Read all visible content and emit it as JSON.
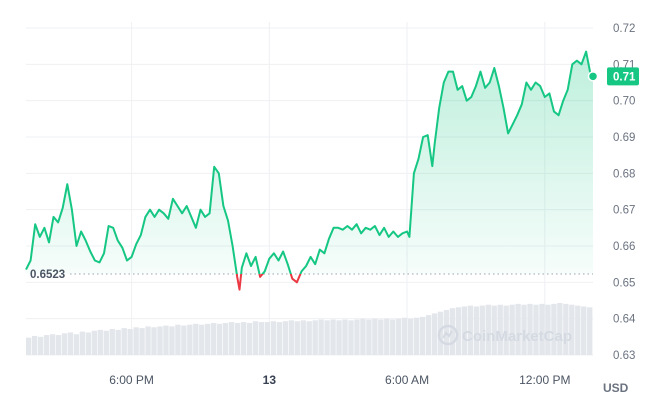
{
  "chart_data": {
    "type": "area",
    "unit": "USD",
    "y_ticks": [
      "0.72",
      "0.71",
      "0.70",
      "0.69",
      "0.68",
      "0.67",
      "0.66",
      "0.65",
      "0.64",
      "0.63"
    ],
    "ylim": [
      0.63,
      0.72
    ],
    "x_ticks": [
      "6:00 PM",
      "13",
      "6:00 AM",
      "12:00 PM"
    ],
    "x_tick_hours": [
      -6,
      0,
      6,
      12
    ],
    "x_range_hours": [
      -10.6,
      14.1
    ],
    "reference_price": 0.6523,
    "reference_label": "0.6523",
    "current_price": 0.7067,
    "current_label": "0.71",
    "colors": {
      "up": "#16c784",
      "down": "#ea3943",
      "grid": "#eef0f3"
    },
    "watermark": "CoinMarketCap",
    "series": [
      {
        "points": [
          [
            -10.6,
            0.6535
          ],
          [
            -10.4,
            0.656
          ],
          [
            -10.2,
            0.666
          ],
          [
            -10.0,
            0.6625
          ],
          [
            -9.8,
            0.665
          ],
          [
            -9.6,
            0.661
          ],
          [
            -9.4,
            0.668
          ],
          [
            -9.2,
            0.6665
          ],
          [
            -9.0,
            0.6705
          ],
          [
            -8.8,
            0.677
          ],
          [
            -8.6,
            0.67
          ],
          [
            -8.4,
            0.66
          ],
          [
            -8.2,
            0.664
          ],
          [
            -8.0,
            0.6615
          ],
          [
            -7.8,
            0.6585
          ],
          [
            -7.6,
            0.656
          ],
          [
            -7.4,
            0.6555
          ],
          [
            -7.2,
            0.658
          ],
          [
            -7.0,
            0.6655
          ],
          [
            -6.8,
            0.665
          ],
          [
            -6.6,
            0.6615
          ],
          [
            -6.4,
            0.6595
          ],
          [
            -6.2,
            0.656
          ],
          [
            -6.0,
            0.657
          ],
          [
            -5.8,
            0.6605
          ],
          [
            -5.6,
            0.663
          ],
          [
            -5.4,
            0.668
          ],
          [
            -5.2,
            0.67
          ],
          [
            -5.0,
            0.668
          ],
          [
            -4.8,
            0.67
          ],
          [
            -4.6,
            0.669
          ],
          [
            -4.4,
            0.6675
          ],
          [
            -4.2,
            0.673
          ],
          [
            -4.0,
            0.671
          ],
          [
            -3.8,
            0.669
          ],
          [
            -3.6,
            0.671
          ],
          [
            -3.4,
            0.668
          ],
          [
            -3.2,
            0.665
          ],
          [
            -3.0,
            0.67
          ],
          [
            -2.8,
            0.668
          ],
          [
            -2.6,
            0.669
          ],
          [
            -2.4,
            0.6818
          ],
          [
            -2.2,
            0.68
          ],
          [
            -2.0,
            0.671
          ],
          [
            -1.8,
            0.667
          ],
          [
            -1.6,
            0.66
          ],
          [
            -1.4,
            0.6515
          ],
          [
            -1.3,
            0.648
          ],
          [
            -1.2,
            0.654
          ],
          [
            -1.0,
            0.658
          ],
          [
            -0.8,
            0.6545
          ],
          [
            -0.6,
            0.657
          ],
          [
            -0.4,
            0.6515
          ],
          [
            -0.2,
            0.653
          ],
          [
            0.0,
            0.6565
          ],
          [
            0.2,
            0.658
          ],
          [
            0.4,
            0.656
          ],
          [
            0.6,
            0.6585
          ],
          [
            0.8,
            0.655
          ],
          [
            1.0,
            0.651
          ],
          [
            1.2,
            0.65
          ],
          [
            1.4,
            0.653
          ],
          [
            1.6,
            0.6545
          ],
          [
            1.8,
            0.657
          ],
          [
            2.0,
            0.655
          ],
          [
            2.2,
            0.659
          ],
          [
            2.4,
            0.658
          ],
          [
            2.6,
            0.662
          ],
          [
            2.8,
            0.665
          ],
          [
            3.0,
            0.665
          ],
          [
            3.2,
            0.6645
          ],
          [
            3.4,
            0.6655
          ],
          [
            3.6,
            0.6645
          ],
          [
            3.8,
            0.666
          ],
          [
            4.0,
            0.6635
          ],
          [
            4.2,
            0.665
          ],
          [
            4.4,
            0.6645
          ],
          [
            4.6,
            0.6655
          ],
          [
            4.8,
            0.663
          ],
          [
            5.0,
            0.665
          ],
          [
            5.2,
            0.6625
          ],
          [
            5.4,
            0.664
          ],
          [
            5.6,
            0.6625
          ],
          [
            5.8,
            0.6635
          ],
          [
            6.0,
            0.664
          ],
          [
            6.1,
            0.6625
          ],
          [
            6.3,
            0.68
          ],
          [
            6.5,
            0.684
          ],
          [
            6.7,
            0.69
          ],
          [
            6.9,
            0.6905
          ],
          [
            7.1,
            0.682
          ],
          [
            7.2,
            0.688
          ],
          [
            7.4,
            0.698
          ],
          [
            7.6,
            0.705
          ],
          [
            7.8,
            0.708
          ],
          [
            8.0,
            0.708
          ],
          [
            8.2,
            0.703
          ],
          [
            8.4,
            0.704
          ],
          [
            8.6,
            0.7
          ],
          [
            8.8,
            0.701
          ],
          [
            9.0,
            0.704
          ],
          [
            9.2,
            0.708
          ],
          [
            9.4,
            0.7035
          ],
          [
            9.6,
            0.705
          ],
          [
            9.8,
            0.709
          ],
          [
            10.0,
            0.704
          ],
          [
            10.2,
            0.698
          ],
          [
            10.4,
            0.691
          ],
          [
            10.6,
            0.6935
          ],
          [
            10.8,
            0.696
          ],
          [
            11.0,
            0.699
          ],
          [
            11.2,
            0.705
          ],
          [
            11.4,
            0.703
          ],
          [
            11.6,
            0.705
          ],
          [
            11.8,
            0.704
          ],
          [
            12.0,
            0.701
          ],
          [
            12.2,
            0.702
          ],
          [
            12.4,
            0.697
          ],
          [
            12.6,
            0.696
          ],
          [
            12.8,
            0.7
          ],
          [
            13.0,
            0.703
          ],
          [
            13.2,
            0.71
          ],
          [
            13.4,
            0.711
          ],
          [
            13.6,
            0.71
          ],
          [
            13.8,
            0.7135
          ],
          [
            14.0,
            0.707
          ],
          [
            14.1,
            0.7067
          ]
        ]
      }
    ],
    "volume": {
      "values": [
        20,
        22,
        21,
        23,
        24,
        23,
        25,
        26,
        24,
        27,
        26,
        28,
        29,
        28,
        30,
        29,
        31,
        30,
        32,
        31,
        33,
        32,
        33,
        34,
        33,
        35,
        34,
        35,
        36,
        35,
        36,
        37,
        36,
        37,
        38,
        37,
        38,
        37,
        39,
        38,
        38,
        39,
        38,
        39,
        40,
        39,
        40,
        39,
        40,
        41,
        40,
        41,
        40,
        41,
        40,
        41,
        42,
        41,
        42,
        41,
        42,
        41,
        42,
        43,
        42,
        43,
        44,
        46,
        48,
        50,
        52,
        54,
        55,
        56,
        57,
        56,
        57,
        58,
        57,
        58,
        57,
        58,
        59,
        58,
        59,
        58,
        59,
        58,
        59,
        60,
        59,
        58,
        57,
        56,
        55
      ]
    }
  }
}
